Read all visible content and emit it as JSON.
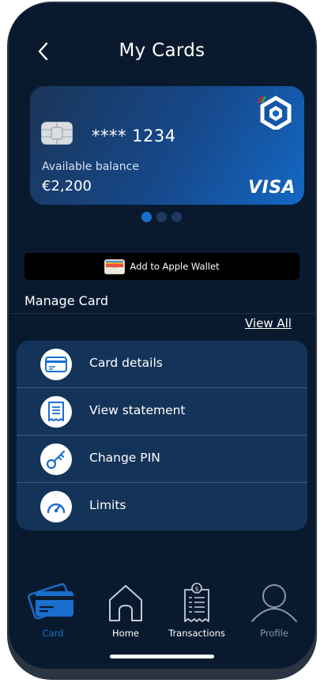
{
  "header": {
    "title": "My Cards"
  },
  "card": {
    "number": "**** 1234",
    "balance_label": "Available balance",
    "balance_value": "€2,200",
    "network": "VISA"
  },
  "carousel": {
    "count": 3,
    "active_index": 0
  },
  "wallet": {
    "label": "Add to Apple Wallet"
  },
  "manage": {
    "title": "Manage Card",
    "view_all": "View All"
  },
  "menu": [
    {
      "label": "Card details",
      "icon": "card-icon"
    },
    {
      "label": "View statement",
      "icon": "statement-icon"
    },
    {
      "label": "Change PIN",
      "icon": "key-icon"
    },
    {
      "label": "Limits",
      "icon": "gauge-icon"
    }
  ],
  "tabs": [
    {
      "label": "Card",
      "icon": "card-icon",
      "state": "active"
    },
    {
      "label": "Home",
      "icon": "home-icon",
      "state": "normal"
    },
    {
      "label": "Transactions",
      "icon": "receipt-icon",
      "state": "normal"
    },
    {
      "label": "Profile",
      "icon": "profile-icon",
      "state": "disabled"
    }
  ],
  "colors": {
    "background": "#0a1a2e",
    "accent": "#1a6ecd",
    "menu_panel": "#143358",
    "card_gradient_start": "#1a3558",
    "card_gradient_end": "#1468c4"
  }
}
